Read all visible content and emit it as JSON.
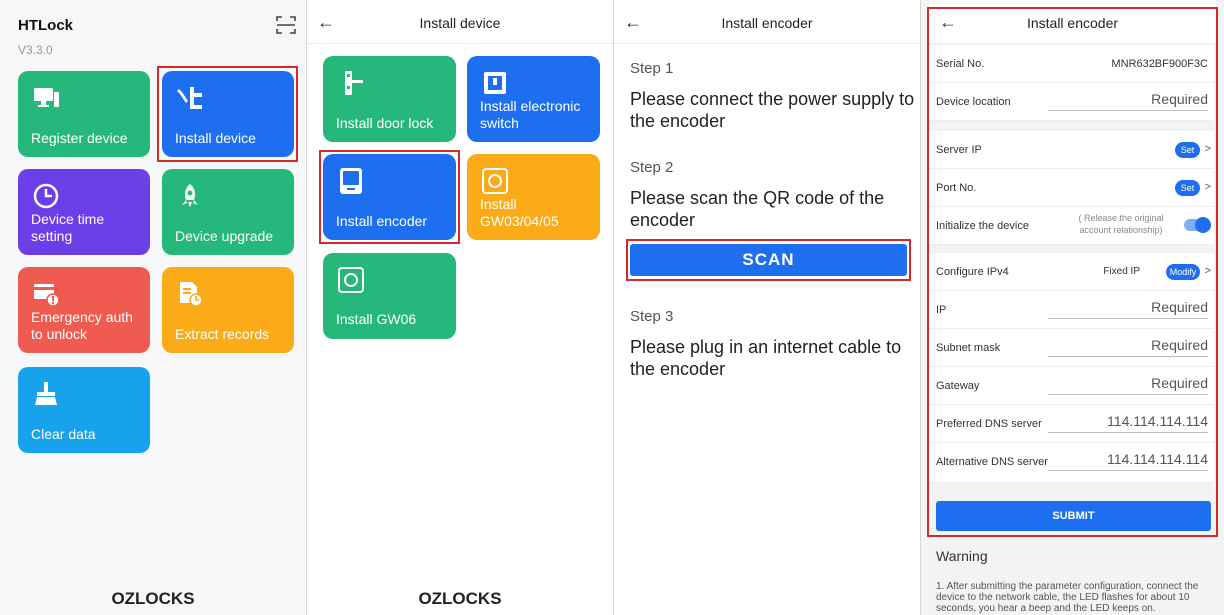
{
  "panel1": {
    "app_title": "HTLock",
    "version": "V3.3.0",
    "tiles": [
      {
        "label": "Register device",
        "icon": "computer-icon"
      },
      {
        "label": "Install device",
        "icon": "wrench-lock-icon"
      },
      {
        "label": "Device time setting",
        "icon": "clock-icon"
      },
      {
        "label": "Device upgrade",
        "icon": "rocket-icon"
      },
      {
        "label": "Emergency auth to unlock",
        "icon": "emergency-unlock-icon"
      },
      {
        "label": "Extract records",
        "icon": "extract-records-icon"
      },
      {
        "label": "Clear data",
        "icon": "broom-icon"
      }
    ],
    "footer": "OZLOCKS"
  },
  "panel2": {
    "title": "Install device",
    "tiles": [
      {
        "label": "Install door lock",
        "icon": "door-lock-icon"
      },
      {
        "label": "Install electronic switch",
        "icon": "switch-icon"
      },
      {
        "label": "Install encoder",
        "icon": "encoder-icon"
      },
      {
        "label": "Install GW03/04/05",
        "icon": "gateway-icon"
      },
      {
        "label": "Install GW06",
        "icon": "gateway-icon"
      }
    ],
    "footer": "OZLOCKS"
  },
  "panel3": {
    "title": "Install encoder",
    "step1_label": "Step 1",
    "step1_line1": "Please connect the power supply to",
    "step1_line2": "the encoder",
    "step2_label": "Step 2",
    "step2_line1": "Please scan the QR code of the",
    "step2_line2": "encoder",
    "scan_label": "SCAN",
    "step3_label": "Step 3",
    "step3_line1": "Please plug in an internet cable to",
    "step3_line2": "the encoder"
  },
  "panel4": {
    "title": "Install encoder",
    "serial_label": "Serial No.",
    "serial_value": "MNR632BF900F3C",
    "location_label": "Device location",
    "location_placeholder": "Required",
    "server_ip_label": "Server IP",
    "port_label": "Port No.",
    "set_label": "Set",
    "init_label": "Initialize the device",
    "init_note": "( Release the original account relationship)",
    "init_enabled": true,
    "ipv4_label": "Configure IPv4",
    "ipv4_value": "Fixed IP",
    "modify_label": "Modify",
    "ip_label": "IP",
    "subnet_label": "Subnet mask",
    "gateway_label": "Gateway",
    "required_placeholder": "Required",
    "dns1_label": "Preferred DNS server",
    "dns1_value": "114.114.114.114",
    "dns2_label": "Alternative DNS server",
    "dns2_value": "114.114.114.114",
    "submit_label": "SUBMIT",
    "warning_title": "Warning",
    "warning_text": "1. After submitting the parameter configuration, connect the device to the network cable, the LED flashes for about 10 seconds, you hear a beep and the LED keeps on."
  },
  "colors": {
    "accent_blue": "#1e6ff0",
    "green": "#26b87a",
    "purple": "#6c3ee8",
    "red": "#ef5b50",
    "orange": "#fbab18",
    "cyan": "#17a3ec",
    "highlight_red": "#d62a2a"
  }
}
